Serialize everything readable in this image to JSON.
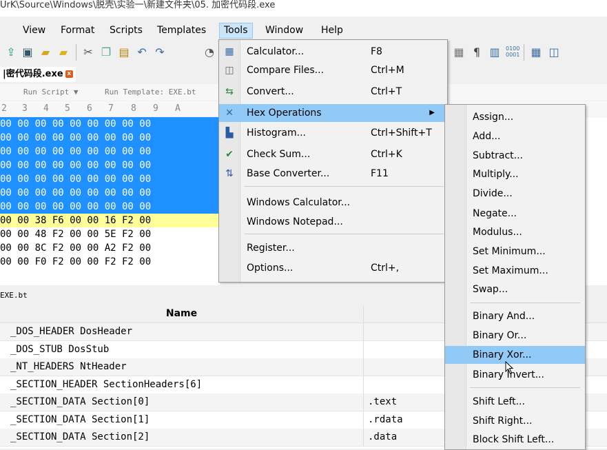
{
  "title": "UrK\\Source\\Windows\\脱壳\\实验一\\新建文件夹\\05. 加密代码段.exe",
  "menubar": {
    "items": [
      "View",
      "Format",
      "Scripts",
      "Templates",
      "Tools",
      "Window",
      "Help"
    ],
    "active": "Tools"
  },
  "toolbar": {
    "icons": [
      "open-icon",
      "save-icon",
      "open-folder-icon",
      "folder-icon",
      "cut-icon",
      "copy-icon",
      "paste-icon",
      "undo-icon",
      "redo-icon",
      "sep",
      "format-icon",
      "pilcrow-icon",
      "columns-icon",
      "binary-icon",
      "calculator-icon",
      "compare-icon"
    ]
  },
  "tab": {
    "label": "|密代码段.exe"
  },
  "runbar": {
    "run_script": "Run Script ▼",
    "run_template": "Run Template: EXE.bt"
  },
  "hexhead": {
    "cols": [
      "2",
      "3",
      "4",
      "5",
      "6",
      "7",
      "8",
      "9",
      "A"
    ]
  },
  "hexrows": [
    {
      "text": "00 00 00 00 00 00 00 00 00",
      "style": "sel"
    },
    {
      "text": "00 00 00 00 00 00 00 00 00",
      "style": "sel"
    },
    {
      "text": "00 00 00 00 00 00 00 00 00",
      "style": "sel"
    },
    {
      "text": "00 00 00 00 00 00 00 00 00",
      "style": "sel"
    },
    {
      "text": "00 00 00 00 00 00 00 00 00",
      "style": "sel"
    },
    {
      "text": "00 00 00 00 00 00 00 00 00",
      "style": "sel"
    },
    {
      "text": "00 00 00 00 00 00 00 00 00",
      "style": "sel"
    },
    {
      "text": "00 00 38 F6 00 00 16 F2 00",
      "style": "yel"
    },
    {
      "text": "00 00 48 F2 00 00 5E F2 00",
      "style": "plain"
    },
    {
      "text": "00 00 8C F2 00 00 A2 F2 00",
      "style": "plain"
    },
    {
      "text": "00 00 F0 F2 00 00 F2 F2 00",
      "style": "plain"
    }
  ],
  "template_bar": {
    "label": "EXE.bt"
  },
  "table": {
    "header": "Name",
    "rows": [
      {
        "name": "_DOS_HEADER DosHeader",
        "value": ""
      },
      {
        "name": "_DOS_STUB DosStub",
        "value": ""
      },
      {
        "name": "_NT_HEADERS NtHeader",
        "value": ""
      },
      {
        "name": "_SECTION_HEADER SectionHeaders[6]",
        "value": ""
      },
      {
        "name": "_SECTION_DATA Section[0]",
        "value": ".text"
      },
      {
        "name": "_SECTION_DATA Section[1]",
        "value": ".rdata"
      },
      {
        "name": "_SECTION_DATA Section[2]",
        "value": ".data"
      }
    ]
  },
  "tools_menu": {
    "items": [
      {
        "label": "Calculator...",
        "shortcut": "F8",
        "icon": "calculator-icon"
      },
      {
        "label": "Compare Files...",
        "shortcut": "Ctrl+M",
        "icon": "compare-icon"
      },
      {
        "label": "Convert...",
        "shortcut": "Ctrl+T",
        "icon": "convert-icon"
      },
      {
        "label": "Hex Operations",
        "shortcut": "",
        "icon": "hex-ops-icon",
        "highlighted": true,
        "submenu": true
      },
      {
        "label": "Histogram...",
        "shortcut": "Ctrl+Shift+T",
        "icon": "histogram-icon"
      },
      {
        "label": "Check Sum...",
        "shortcut": "Ctrl+K",
        "icon": "checksum-icon"
      },
      {
        "label": "Base Converter...",
        "shortcut": "F11",
        "icon": "base-converter-icon"
      },
      {
        "label": "Windows Calculator...",
        "shortcut": "",
        "icon": ""
      },
      {
        "label": "Windows Notepad...",
        "shortcut": "",
        "icon": ""
      },
      {
        "label": "Register...",
        "shortcut": "",
        "icon": ""
      },
      {
        "label": "Options...",
        "shortcut": "Ctrl+,",
        "icon": ""
      }
    ]
  },
  "hex_submenu": {
    "items": [
      "Assign...",
      "Add...",
      "Subtract...",
      "Multiply...",
      "Divide...",
      "Negate...",
      "Modulus...",
      "Set Minimum...",
      "Set Maximum...",
      "Swap...",
      "Binary And...",
      "Binary Or...",
      "Binary Xor...",
      "Binary Invert...",
      "Shift Left...",
      "Shift Right...",
      "Block Shift Left..."
    ],
    "highlighted": "Binary Xor..."
  }
}
